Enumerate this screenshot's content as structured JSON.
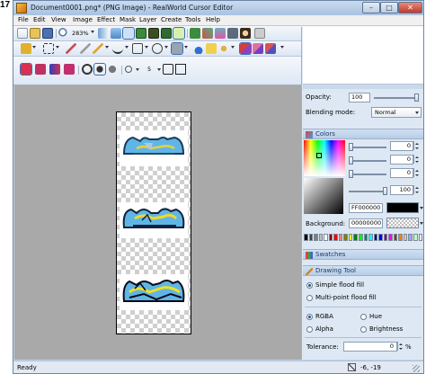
{
  "figure": {
    "label": "17"
  },
  "window": {
    "title": "Document0001.png* (PNG Image) - RealWorld Cursor Editor",
    "controls": {
      "minimize": "–",
      "maximize": "□",
      "close": "✕"
    }
  },
  "menu": {
    "items": [
      "File",
      "Edit",
      "View",
      "Image",
      "Effect",
      "Mask",
      "Layer",
      "Create",
      "Tools",
      "Help"
    ]
  },
  "toolbar": {
    "zoom_value": "283%",
    "brush_size_value": "5"
  },
  "document": {
    "frames": 3,
    "background": "transparent"
  },
  "layer_panel": {
    "opacity_label": "Opacity:",
    "opacity_value": "100",
    "blending_label": "Blending mode:",
    "blending_value": "Normal"
  },
  "colors_panel": {
    "title": "Colors",
    "channels": [
      {
        "name": "red",
        "value": "0",
        "color": "#c02020"
      },
      {
        "name": "green",
        "value": "0",
        "color": "#20a020"
      },
      {
        "name": "blue",
        "value": "0",
        "color": "#2040c0"
      },
      {
        "name": "alpha",
        "value": "100",
        "color": "#707070"
      }
    ],
    "hex_value": "FF000000",
    "background_label": "Background:",
    "background_value": "00000000",
    "swatches": [
      "#000000",
      "#404040",
      "#808080",
      "#c0c0c0",
      "#ffffff",
      "#800000",
      "#ff0000",
      "#ff8080",
      "#808000",
      "#ffff00",
      "#008000",
      "#00ff00",
      "#008080",
      "#00ffff",
      "#000080",
      "#0000ff",
      "#800080",
      "#ff00ff",
      "#804000",
      "#ff8000",
      "#ffc0a0",
      "#a0a0ff",
      "#c0ffc0",
      "#ffe0ff"
    ]
  },
  "swatches_panel": {
    "title": "Swatches"
  },
  "drawing_tool_panel": {
    "title": "Drawing Tool",
    "fill_options": [
      {
        "label": "Simple flood fill",
        "selected": true
      },
      {
        "label": "Multi-point flood fill",
        "selected": false
      }
    ],
    "mode_options": [
      {
        "label": "RGBA",
        "selected": true
      },
      {
        "label": "Hue",
        "selected": false
      },
      {
        "label": "Alpha",
        "selected": false
      },
      {
        "label": "Brightness",
        "selected": false
      }
    ],
    "tolerance_label": "Tolerance:",
    "tolerance_value": "0",
    "tolerance_unit": "%"
  },
  "status": {
    "text": "Ready",
    "coords": "-6, -19"
  }
}
